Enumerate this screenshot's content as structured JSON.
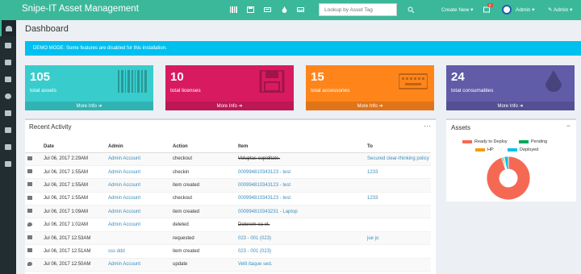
{
  "app": {
    "title": "Snipe-IT Asset Management"
  },
  "topnav": {
    "search_placeholder": "Lookup by Asset Tag",
    "create_new": "Create New",
    "badge_count": "0",
    "admin_label": "Admin",
    "admin_label2": "Admin"
  },
  "page": {
    "title": "Dashboard"
  },
  "demo_notice": "DEMO MODE: Some features are disabled for this installation.",
  "stats": [
    {
      "count": "105",
      "label": "total assets",
      "more": "More Info",
      "color": "#39cccc"
    },
    {
      "count": "10",
      "label": "total licenses",
      "more": "More Info",
      "color": "#d81b60"
    },
    {
      "count": "15",
      "label": "total accessories",
      "more": "More Info",
      "color": "#ff851b"
    },
    {
      "count": "24",
      "label": "total consumables",
      "more": "More Info",
      "color": "#605ca8"
    }
  ],
  "activity": {
    "title": "Recent Activity",
    "headers": [
      "",
      "Date",
      "Admin",
      "Action",
      "Item",
      "To"
    ],
    "rows": [
      {
        "icon": "inbox-icon",
        "date": "Jul 06, 2017 2:29AM",
        "admin": "Admin Account",
        "action": "checkout",
        "item": "Voluptas cupiditate.",
        "to": "Secured clear-thinking policy"
      },
      {
        "icon": "barcode-icon",
        "date": "Jul 06, 2017 1:55AM",
        "admin": "Admin Account",
        "action": "checkin",
        "item": "000994810343123 - test",
        "to": "1233"
      },
      {
        "icon": "barcode-icon",
        "date": "Jul 06, 2017 1:55AM",
        "admin": "Admin Account",
        "action": "item created",
        "item": "000994810343123 - test",
        "to": ""
      },
      {
        "icon": "barcode-icon",
        "date": "Jul 06, 2017 1:55AM",
        "admin": "Admin Account",
        "action": "checkout",
        "item": "000994810343123 - test",
        "to": "1233"
      },
      {
        "icon": "barcode-icon",
        "date": "Jul 06, 2017 1:09AM",
        "admin": "Admin Account",
        "action": "item created",
        "item": "000994810343231 - Laptop",
        "to": ""
      },
      {
        "icon": "drop-icon",
        "date": "Jul 06, 2017 1:02AM",
        "admin": "Admin Account",
        "action": "deleted",
        "item": "Dolorem ea et.",
        "to": ""
      },
      {
        "icon": "barcode-icon",
        "date": "Jul 06, 2017 12:53AM",
        "admin": "",
        "action": "requested",
        "item": "023 - 001 (023)",
        "to": "jue jo"
      },
      {
        "icon": "barcode-icon",
        "date": "Jul 06, 2017 12:51AM",
        "admin": "sss ddd",
        "action": "item created",
        "item": "023 - 001 (023)",
        "to": ""
      },
      {
        "icon": "drop-icon",
        "date": "Jul 06, 2017 12:50AM",
        "admin": "Admin Account",
        "action": "update",
        "item": "Velit itaque sed.",
        "to": ""
      }
    ]
  },
  "assets_panel": {
    "title": "Assets",
    "legend": [
      {
        "label": "Ready to Deploy",
        "color": "#f56954"
      },
      {
        "label": "Pending",
        "color": "#00a65a"
      },
      {
        "label": "HP",
        "color": "#f39c12"
      },
      {
        "label": "Deployed",
        "color": "#00c0ef"
      }
    ],
    "donut": [
      {
        "label": "Ready to Deploy",
        "fraction": 0.95
      },
      {
        "label": "Pending",
        "fraction": 0.01
      },
      {
        "label": "HP",
        "fraction": 0.01
      },
      {
        "label": "Deployed",
        "fraction": 0.03
      }
    ]
  }
}
